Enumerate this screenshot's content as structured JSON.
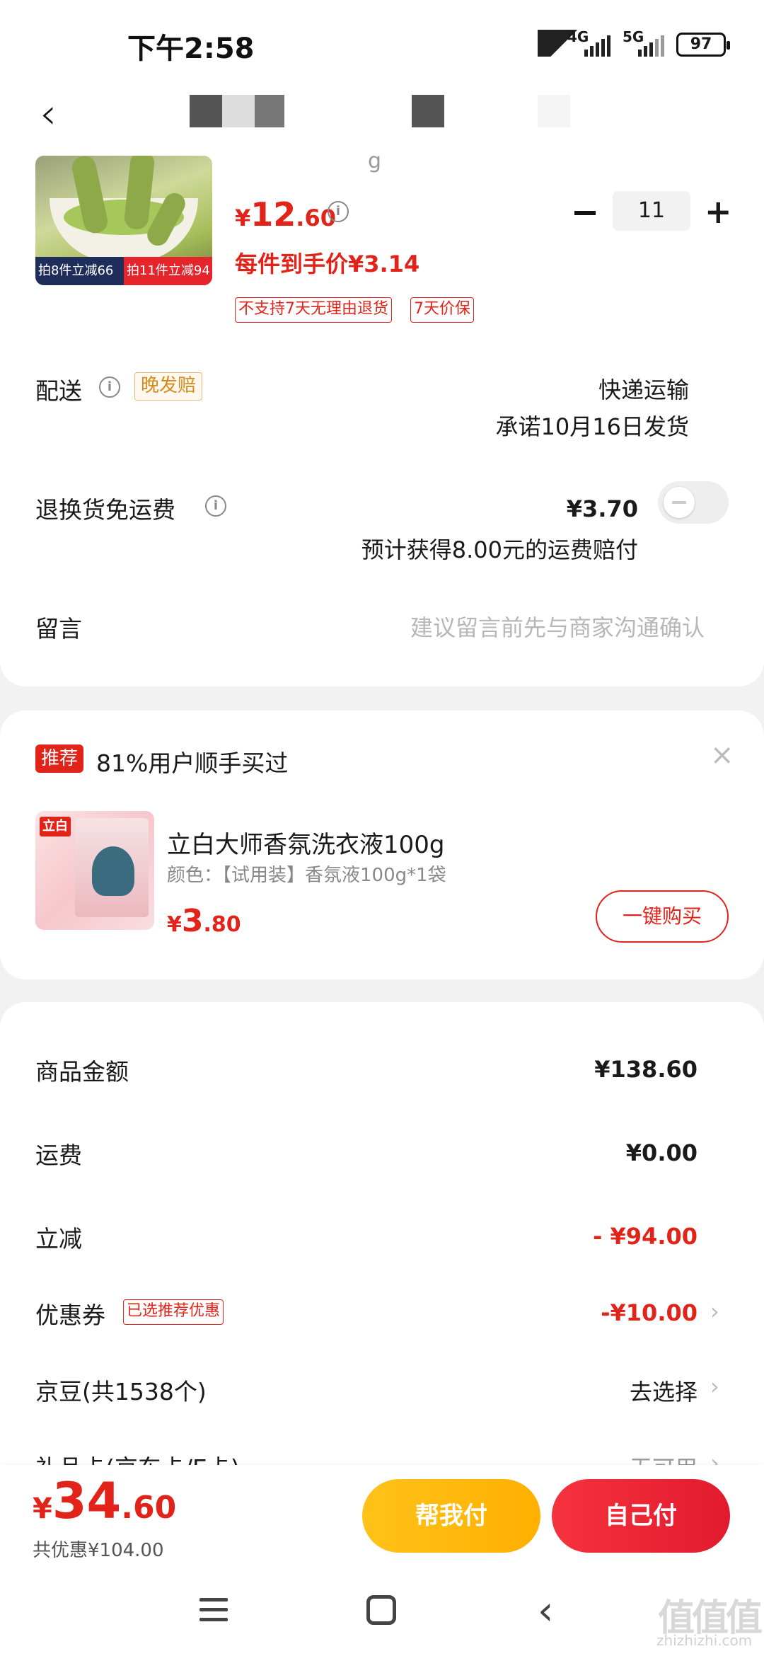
{
  "status_bar": {
    "time": "下午2:58",
    "net1": "4G",
    "net2": "5G",
    "battery": "97"
  },
  "item": {
    "price_symbol": "¥",
    "price_int": "12",
    "price_dec": ".60",
    "per_unit": "每件到手价¥3.14",
    "promo_left": "拍8件立减66",
    "promo_right": "拍11件立减94",
    "tags": [
      "不支持7天无理由退货",
      "7天价保"
    ],
    "quantity": "11",
    "partial_title": "g"
  },
  "delivery": {
    "label": "配送",
    "badge": "晚发赔",
    "method": "快递运输",
    "promise": "承诺10月16日发货"
  },
  "return_shipping": {
    "label": "退换货免运费",
    "price": "¥3.70",
    "note": "预计获得8.00元的运费赔付",
    "enabled": false
  },
  "message": {
    "label": "留言",
    "placeholder": "建议留言前先与商家沟通确认"
  },
  "recommend": {
    "badge": "推荐",
    "title": "81%用户顺手买过",
    "product_name": "立白大师香氛洗衣液100g",
    "product_attr": "颜色：【试用装】香氛液100g*1袋",
    "price_symbol": "¥",
    "price_int": "3",
    "price_dec": ".80",
    "buy_label": "一键购买",
    "logo_text": "立白"
  },
  "summary": {
    "goods_label": "商品金额",
    "goods_value": "¥138.60",
    "freight_label": "运费",
    "freight_value": "¥0.00",
    "discount_label": "立减",
    "discount_value": "- ¥94.00",
    "coupon_label": "优惠券",
    "coupon_tag": "已选推荐优惠",
    "coupon_value": "-¥10.00",
    "jingdou_label": "京豆(共1538个)",
    "jingdou_value": "去选择",
    "giftcard_label": "礼品卡(京东卡/E卡)",
    "giftcard_value": "无可用"
  },
  "footer": {
    "total_symbol": "¥",
    "total_int": "34",
    "total_dec": ".60",
    "saved": "共优惠¥104.00",
    "help_pay": "帮我付",
    "self_pay": "自己付"
  },
  "watermark": {
    "main": "值值值",
    "sub": "zhizhizhi.com"
  },
  "colors": {
    "accent_red": "#e2231a",
    "help_btn": "#ffb000",
    "pay_btn": "#e21a2e"
  }
}
